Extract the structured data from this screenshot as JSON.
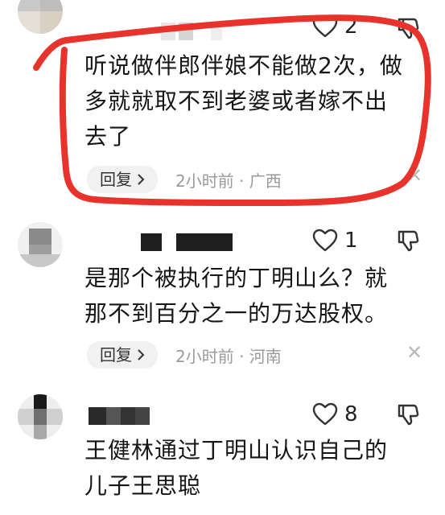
{
  "colors": {
    "annotation_red": "#e8332c",
    "meta_gray": "#9a9a9a",
    "reply_bg": "#f1f1f1"
  },
  "comments": [
    {
      "like_count": "2",
      "text_lines": [
        "听说做伴郎伴娘不能做2次，做",
        "多就就取不到老婆或者嫁不出",
        "去了"
      ],
      "reply_label": "回复",
      "time_location": "2小时前 · 广西"
    },
    {
      "like_count": "1",
      "text_lines": [
        "是那个被执行的丁明山么？就",
        "那不到百分之一的万达股权。"
      ],
      "reply_label": "回复",
      "time_location": "2小时前 · 河南"
    },
    {
      "like_count": "8",
      "text_lines": [
        "王健林通过丁明山认识自己的",
        "儿子王思聪"
      ]
    }
  ],
  "icons": {
    "like": "heart-outline-icon",
    "dislike": "thumbs-down-icon",
    "reply_arrow": "chevron-right-icon",
    "close": "close-icon"
  }
}
